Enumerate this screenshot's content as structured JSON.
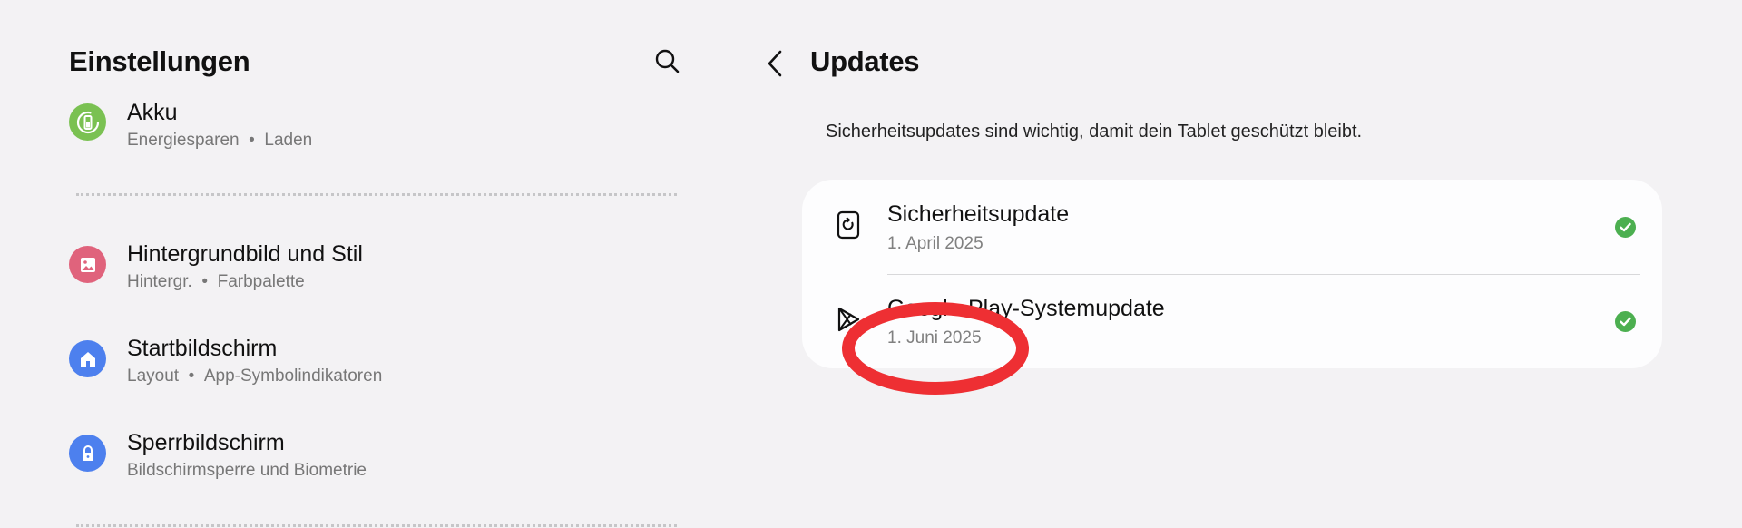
{
  "left": {
    "title": "Einstellungen",
    "items": [
      {
        "title": "Akku",
        "sub1": "Energiesparen",
        "sub2": "Laden",
        "icon": "battery-icon",
        "color": "#7ac152"
      },
      {
        "title": "Hintergrundbild und Stil",
        "sub1": "Hintergr.",
        "sub2": "Farbpalette",
        "icon": "image-icon",
        "color": "#e0637c"
      },
      {
        "title": "Startbildschirm",
        "sub1": "Layout",
        "sub2": "App-Symbolindikatoren",
        "icon": "home-icon",
        "color": "#4d80ee"
      },
      {
        "title": "Sperrbildschirm",
        "sub1": "Bildschirmsperre und Biometrie",
        "icon": "lock-icon",
        "color": "#4d80ee"
      }
    ],
    "separator": "•"
  },
  "right": {
    "title": "Updates",
    "info": "Sicherheitsupdates sind wichtig, damit dein Tablet geschützt bleibt.",
    "updates": [
      {
        "title": "Sicherheitsupdate",
        "date": "1. April 2025",
        "status": "up-to-date",
        "icon": "security-update-icon"
      },
      {
        "title": "Google-Play-Systemupdate",
        "date": "1. Juni 2025",
        "status": "up-to-date",
        "icon": "google-play-icon"
      }
    ]
  },
  "colors": {
    "check": "#4caf50",
    "annotation": "#ee2f33",
    "background": "#f3f2f4"
  }
}
